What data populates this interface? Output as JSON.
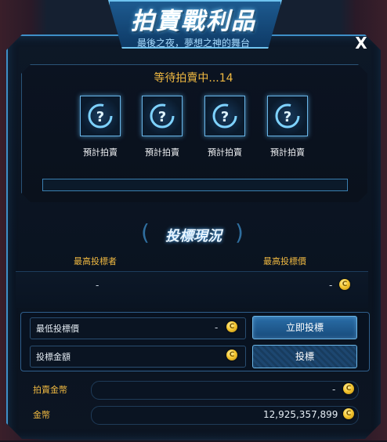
{
  "window": {
    "title": "拍賣戰利品",
    "subtitle": "最後之夜，夢想之神的舞台",
    "close_label": "X"
  },
  "waiting": {
    "status_text": "等待拍賣中...14"
  },
  "items": [
    {
      "label": "預計拍賣",
      "icon": "question-mark-icon"
    },
    {
      "label": "預計拍賣",
      "icon": "question-mark-icon"
    },
    {
      "label": "預計拍賣",
      "icon": "question-mark-icon"
    },
    {
      "label": "預計拍賣",
      "icon": "question-mark-icon"
    }
  ],
  "bidding": {
    "title": "投標現況",
    "highest_bidder_label": "最高投標者",
    "highest_bid_label": "最高投標價",
    "highest_bidder_value": "-",
    "highest_bid_value": "-"
  },
  "inputs": {
    "min_bid_label": "最低投標價",
    "min_bid_value": "-",
    "bid_amount_label": "投標金額",
    "bid_amount_value": "",
    "bid_now_button": "立即投標",
    "bid_button": "投標"
  },
  "balances": {
    "auction_coin_label": "拍賣金幣",
    "auction_coin_value": "-",
    "gold_label": "金幣",
    "gold_value": "12,925,357,899"
  },
  "colors": {
    "accent": "#3e8fc7",
    "gold_text": "#f0b941"
  }
}
